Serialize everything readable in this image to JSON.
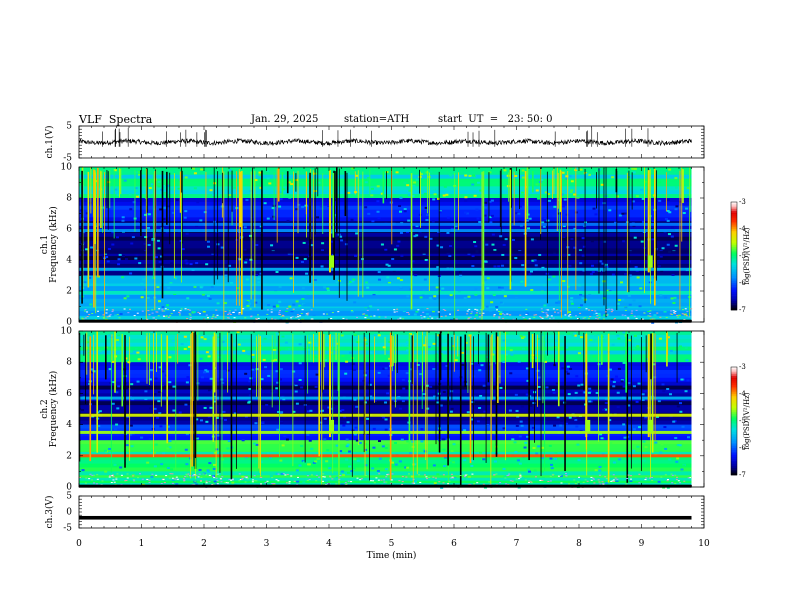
{
  "header": {
    "title": "VLF  Spectra",
    "date": "Jan. 29, 2025",
    "station": "station=ATH",
    "start": "start  UT  =   23: 50: 0"
  },
  "colors": {
    "waveform": "#000000",
    "colormap": [
      "#000000",
      "#0000a0",
      "#0010ff",
      "#0090ff",
      "#00e0e0",
      "#00ff60",
      "#c0ff00",
      "#ffd000",
      "#ff3000",
      "#e00000",
      "#ffc0c0",
      "#ffffff"
    ]
  },
  "chart_data": [
    {
      "type": "line",
      "panel": "ch1-waveform",
      "ylabel": "ch.1(V)",
      "ylim": [
        -5,
        5
      ],
      "yticks": [
        "5",
        "-5"
      ],
      "xlim": [
        0,
        10
      ],
      "description_series": "noise waveform around 0 V",
      "x": [
        0,
        9.8
      ],
      "y_baseline": 0
    },
    {
      "type": "heatmap",
      "panel": "ch1-spectrogram",
      "ylabel_top": "ch.1",
      "ylabel": "Frequency  (kHz)",
      "ylim": [
        0,
        10
      ],
      "yticks": [
        "0",
        "2",
        "4",
        "6",
        "8",
        "10"
      ],
      "xlim": [
        0,
        10
      ],
      "data_extent_min": 9.8,
      "colorbar": {
        "label": "log(PSD)(V²/Hz)",
        "range": [
          -7,
          -3
        ],
        "ticks": [
          "-3",
          "-4",
          "-5",
          "-6",
          "-7"
        ]
      },
      "bands_khz": [
        {
          "freq": 0.3,
          "level": -5.4
        },
        {
          "freq": 0.8,
          "level": -5.6
        },
        {
          "freq": 1.9,
          "level": -5.2
        },
        {
          "freq": 2.4,
          "level": -5.4
        },
        {
          "freq": 3.4,
          "level": -5.6
        },
        {
          "freq": 4.5,
          "level": -6.8
        },
        {
          "freq": 5.9,
          "level": -5.8
        },
        {
          "freq": 6.3,
          "level": -5.9
        }
      ],
      "bright_events_min": [
        4.0,
        9.1
      ]
    },
    {
      "type": "heatmap",
      "panel": "ch2-spectrogram",
      "ylabel_top": "ch.2",
      "ylabel": "Frequency  (kHz)",
      "ylim": [
        0,
        10
      ],
      "yticks": [
        "0",
        "2",
        "4",
        "6",
        "8",
        "10"
      ],
      "xlim": [
        0,
        10
      ],
      "data_extent_min": 9.8,
      "colorbar": {
        "label": "log(PSD)(V²/Hz)",
        "range": [
          -7,
          -3
        ],
        "ticks": [
          "-3",
          "-4",
          "-5",
          "-6",
          "-7"
        ]
      },
      "bands_khz": [
        {
          "freq": 0.5,
          "level": -5.2
        },
        {
          "freq": 2.0,
          "level": -3.8
        },
        {
          "freq": 3.5,
          "level": -4.6
        },
        {
          "freq": 4.6,
          "level": -4.4
        },
        {
          "freq": 5.7,
          "level": -5.6
        }
      ],
      "bright_events_min": [
        4.0,
        8.1,
        9.1
      ]
    },
    {
      "type": "line",
      "panel": "ch3-waveform",
      "ylabel": "ch.3(V)",
      "ylim": [
        -5,
        5
      ],
      "yticks": [
        "5",
        "0",
        "-5"
      ],
      "xlim": [
        0,
        10
      ],
      "xlabel": "Time  (min)",
      "xticks": [
        "0",
        "1",
        "2",
        "3",
        "4",
        "5",
        "6",
        "7",
        "8",
        "9",
        "10"
      ],
      "x": [
        0,
        9.8
      ],
      "y_baseline": -1.8
    }
  ]
}
